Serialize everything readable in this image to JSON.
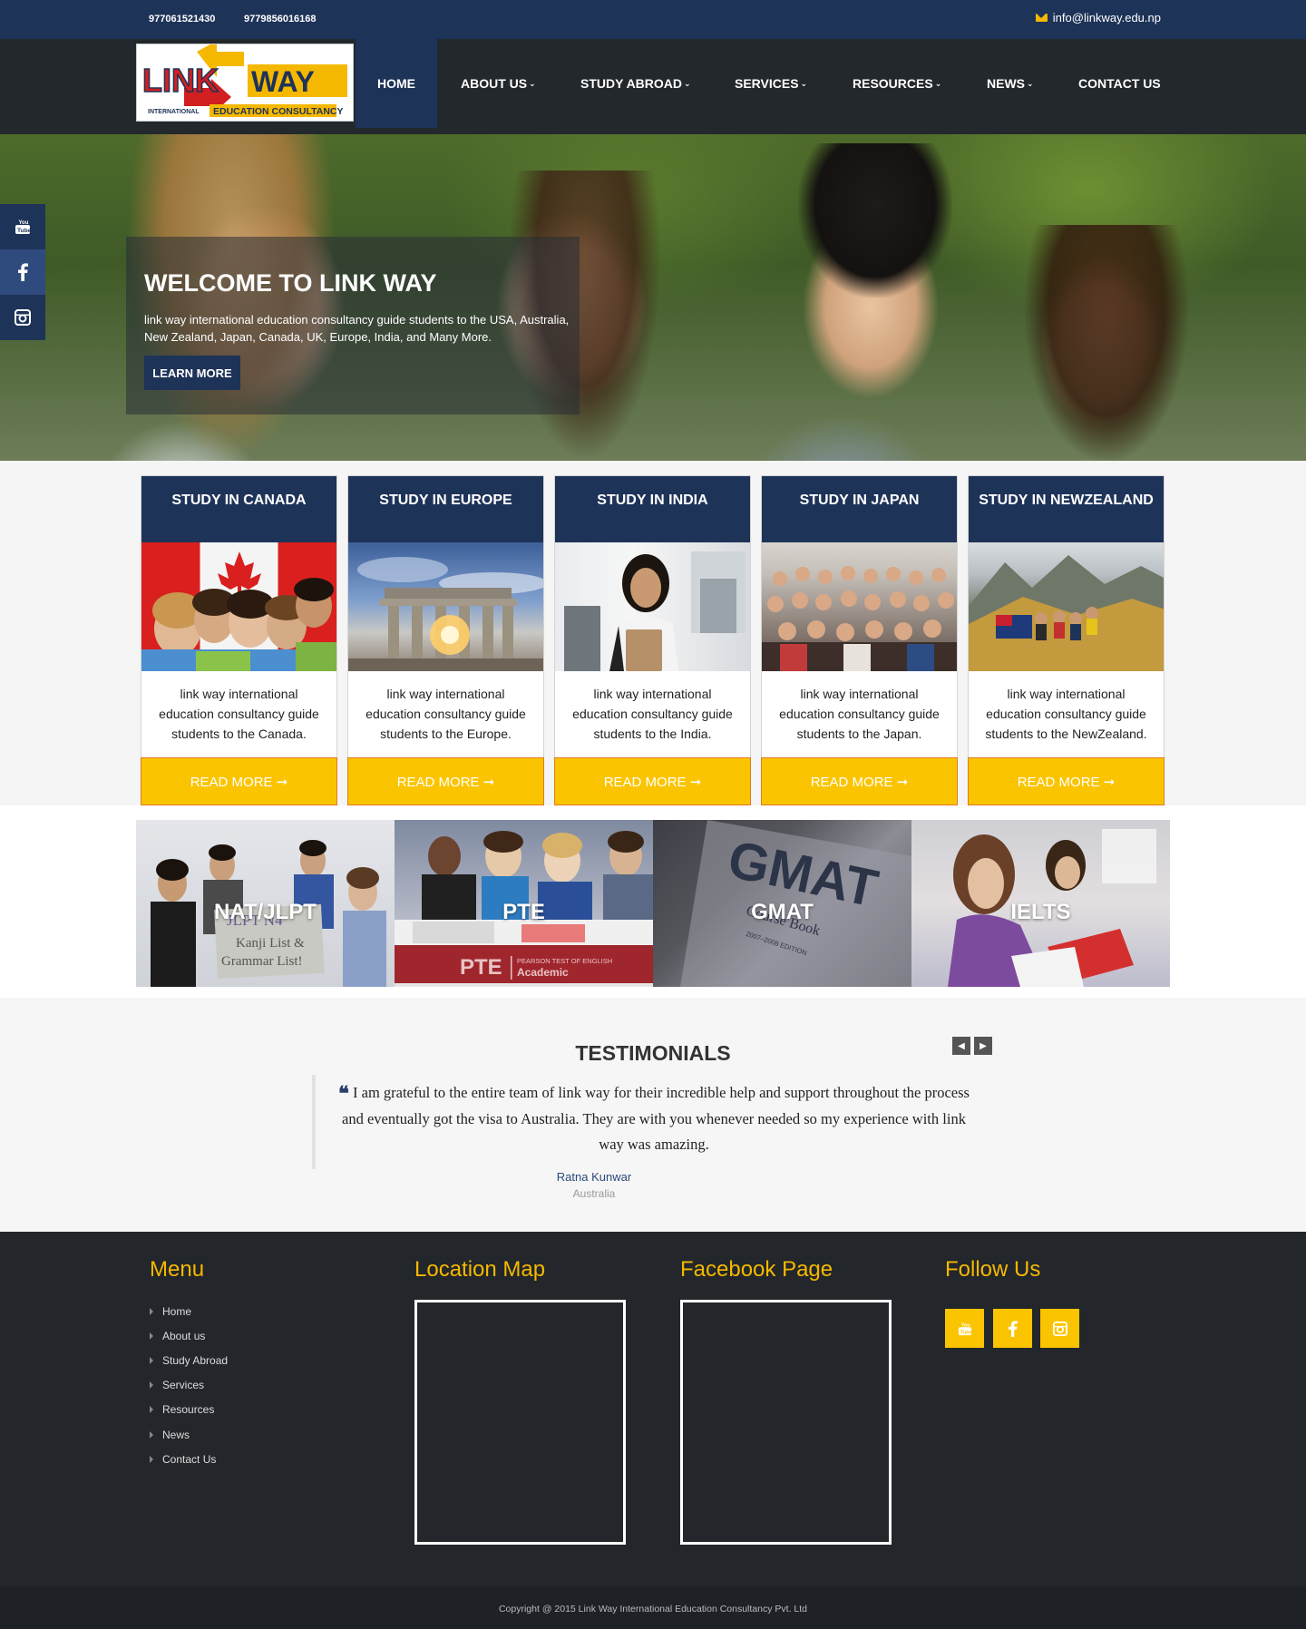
{
  "topbar": {
    "phone1": "977061521430",
    "phone2": "9779856016168",
    "email": "info@linkway.edu.np",
    "email_icon": "envelope-icon"
  },
  "logo": {
    "text_link": "LINK",
    "text_way": "WAY",
    "tagline_small": "INTERNATIONAL",
    "tagline": "EDUCATION CONSULTANCY"
  },
  "nav": {
    "items": [
      {
        "label": "HOME",
        "dropdown": false
      },
      {
        "label": "ABOUT US",
        "dropdown": true
      },
      {
        "label": "STUDY ABROAD",
        "dropdown": true
      },
      {
        "label": "SERVICES",
        "dropdown": true
      },
      {
        "label": "RESOURCES",
        "dropdown": true
      },
      {
        "label": "NEWS",
        "dropdown": true
      },
      {
        "label": "CONTACT US",
        "dropdown": false
      }
    ],
    "caret": "⌄"
  },
  "hero": {
    "title": "WELCOME TO LINK WAY",
    "text": "link way international education consultancy guide students to the USA, Australia, New Zealand, Japan, Canada, UK, Europe, India, and Many More.",
    "button": "LEARN MORE"
  },
  "side_social": [
    "youtube-icon",
    "facebook-icon",
    "instagram-icon"
  ],
  "countries": [
    {
      "title": "STUDY IN CANADA",
      "text": "link way international education consultancy guide students to the Canada.",
      "button": "READ MORE ➞"
    },
    {
      "title": "STUDY IN EUROPE",
      "text": "link way international education consultancy guide students to the Europe.",
      "button": "READ MORE ➞"
    },
    {
      "title": "STUDY IN INDIA",
      "text": "link way international education consultancy guide students to the India.",
      "button": "READ MORE ➞"
    },
    {
      "title": "STUDY IN JAPAN",
      "text": "link way international education consultancy guide students to the Japan.",
      "button": "READ MORE ➞"
    },
    {
      "title": "STUDY IN NEWZEALAND",
      "text": "link way international education consultancy guide students to the NewZealand.",
      "button": "READ MORE ➞"
    }
  ],
  "tests": [
    {
      "label": "NAT/JLPT",
      "sign_line1": "JLPT N4",
      "sign_line2": "Kanji List &",
      "sign_line3": "Grammar List!"
    },
    {
      "label": "PTE",
      "banner_logo": "PTE",
      "banner_line1": "PEARSON TEST OF ENGLISH",
      "banner_line2": "Academic"
    },
    {
      "label": "GMAT",
      "book_title": "GMAT",
      "book_sub": "Course Book",
      "book_edition": "2007–2008 EDITION"
    },
    {
      "label": "IELTS"
    }
  ],
  "testimonials": {
    "title": "TESTIMONIALS",
    "prev": "◀",
    "next": "▶",
    "quote_icon": "❝",
    "quote": "I am grateful to the entire team of link way for their incredible help and support throughout the process and eventually got the visa to Australia. They are with you whenever needed so my experience with link way was amazing.",
    "author": "Ratna Kunwar",
    "country": "Australia"
  },
  "footer": {
    "menu_title": "Menu",
    "menu": [
      "Home",
      "About us",
      "Study Abroad",
      "Services",
      "Resources",
      "News",
      "Contact Us"
    ],
    "map_title": "Location Map",
    "facebook_title": "Facebook Page",
    "follow_title": "Follow Us",
    "follow_icons": [
      "youtube-icon",
      "facebook-icon",
      "instagram-icon"
    ],
    "copyright": "Copyright @ 2015 Link Way International Education Consultancy Pvt. Ltd"
  },
  "colors": {
    "navy": "#1e3358",
    "yellow": "#fbc400",
    "dark": "#23282d"
  }
}
